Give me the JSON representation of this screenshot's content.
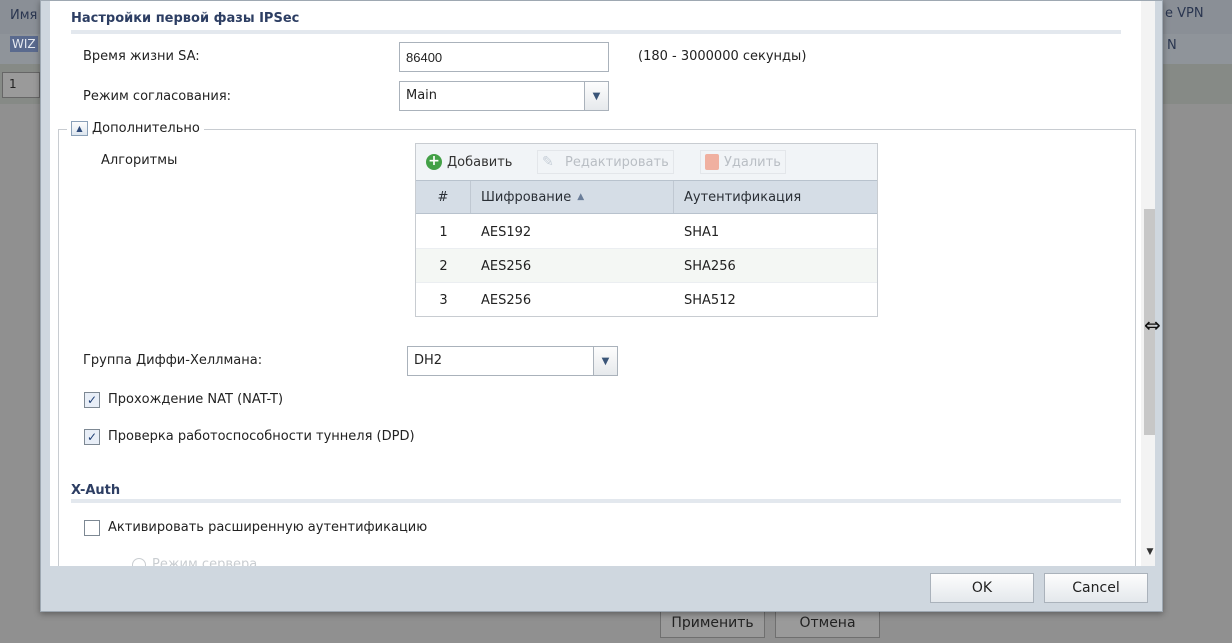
{
  "background": {
    "header_left": "Имя",
    "header_right": "e VPN",
    "row_left": "WIZ",
    "row_right": "N",
    "row_input": "1",
    "apply_label": "Применить",
    "cancel_label": "Отмена"
  },
  "dialog": {
    "phase1_title": "Настройки первой фазы IPSec",
    "sa_lifetime_label": "Время жизни SA:",
    "sa_lifetime_value": "86400",
    "sa_lifetime_hint": "(180 - 3000000 секунды)",
    "negotiation_label": "Режим согласования:",
    "negotiation_value": "Main",
    "advanced_legend": "Дополнительно",
    "algorithms_label": "Алгоритмы",
    "toolbar": {
      "add": "Добавить",
      "edit": "Редактировать",
      "delete": "Удалить"
    },
    "grid": {
      "headers": [
        "#",
        "Шифрование",
        "Аутентификация"
      ],
      "rows": [
        {
          "num": "1",
          "enc": "AES192",
          "auth": "SHA1"
        },
        {
          "num": "2",
          "enc": "AES256",
          "auth": "SHA256"
        },
        {
          "num": "3",
          "enc": "AES256",
          "auth": "SHA512"
        }
      ]
    },
    "dh_label": "Группа Диффи-Хеллмана:",
    "dh_value": "DH2",
    "nat_label": "Прохождение NAT (NAT-T)",
    "dpd_label": "Проверка работоспособности туннеля (DPD)",
    "xauth_title": "X-Auth",
    "xauth_enable_label": "Активировать расширенную аутентификацию",
    "faded_radio_label": "Режим сервера",
    "ok_label": "OK",
    "cancel_label": "Cancel"
  },
  "colors": {
    "section_title": "#2d3e63",
    "grid_header": "#d5dde6",
    "add_icon": "#43a047"
  },
  "icons": [
    "collapse-up-icon",
    "add-icon",
    "edit-icon",
    "delete-icon",
    "sort-asc-icon",
    "chevron-down-icon",
    "checkmark-icon",
    "resize-cursor-icon",
    "scroll-down-icon"
  ]
}
